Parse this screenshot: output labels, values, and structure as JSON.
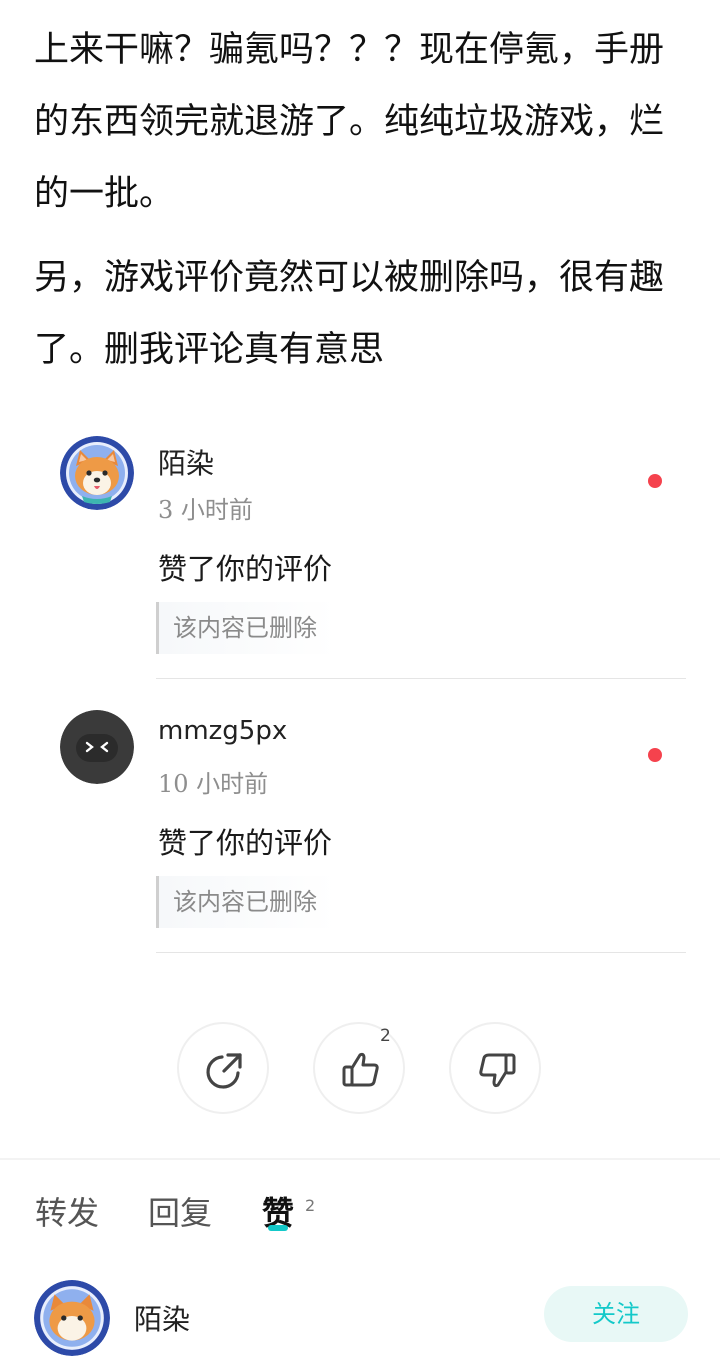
{
  "review": {
    "paragraphs": [
      "上来干嘛？骗氪吗？？？现在停氪，手册的东西领完就退游了。纯纯垃圾游戏，烂的一批。",
      "另，游戏评价竟然可以被删除吗，很有趣了。删我评论真有意思"
    ]
  },
  "notifications": [
    {
      "username": "陌染",
      "time": "3 小时前",
      "action": "赞了你的评价",
      "quote": "该内容已删除",
      "avatar_icon": "shiba-dog-avatar-icon"
    },
    {
      "username": "mmzg5px",
      "time": "10 小时前",
      "action": "赞了你的评价",
      "quote": "该内容已删除",
      "avatar_icon": "dark-face-avatar-icon"
    }
  ],
  "actions": {
    "share_icon": "share-icon",
    "like_icon": "thumbs-up-icon",
    "like_count": "2",
    "dislike_icon": "thumbs-down-icon"
  },
  "tabs": {
    "repost": "转发",
    "reply": "回复",
    "like": "赞",
    "like_count": "2"
  },
  "bottom": {
    "name": "陌染",
    "follow_label": "关注"
  },
  "colors": {
    "unread_dot": "#f5424d",
    "accent": "#14c9c9",
    "follow_bg": "#e8f8f6"
  }
}
